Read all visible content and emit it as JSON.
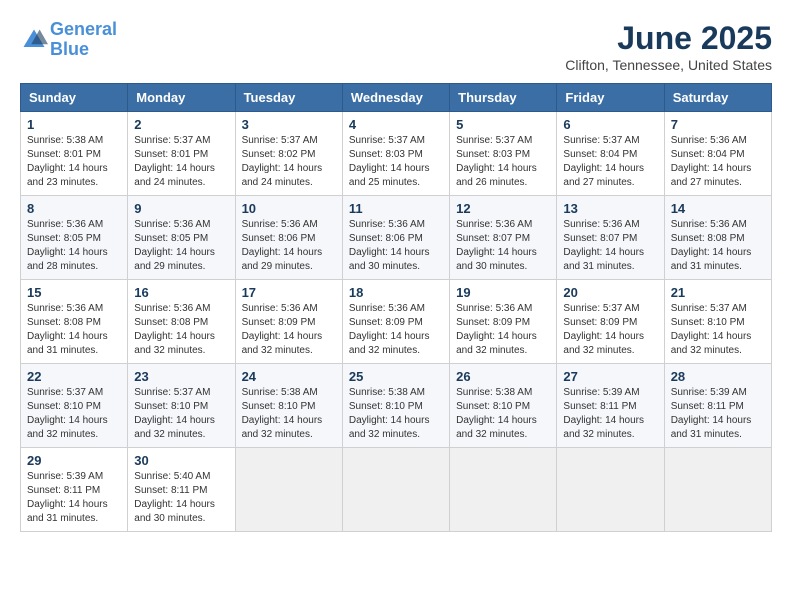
{
  "logo": {
    "line1": "General",
    "line2": "Blue"
  },
  "title": "June 2025",
  "location": "Clifton, Tennessee, United States",
  "headers": [
    "Sunday",
    "Monday",
    "Tuesday",
    "Wednesday",
    "Thursday",
    "Friday",
    "Saturday"
  ],
  "weeks": [
    [
      {
        "day": "1",
        "sunrise": "5:38 AM",
        "sunset": "8:01 PM",
        "daylight": "14 hours and 23 minutes."
      },
      {
        "day": "2",
        "sunrise": "5:37 AM",
        "sunset": "8:01 PM",
        "daylight": "14 hours and 24 minutes."
      },
      {
        "day": "3",
        "sunrise": "5:37 AM",
        "sunset": "8:02 PM",
        "daylight": "14 hours and 24 minutes."
      },
      {
        "day": "4",
        "sunrise": "5:37 AM",
        "sunset": "8:03 PM",
        "daylight": "14 hours and 25 minutes."
      },
      {
        "day": "5",
        "sunrise": "5:37 AM",
        "sunset": "8:03 PM",
        "daylight": "14 hours and 26 minutes."
      },
      {
        "day": "6",
        "sunrise": "5:37 AM",
        "sunset": "8:04 PM",
        "daylight": "14 hours and 27 minutes."
      },
      {
        "day": "7",
        "sunrise": "5:36 AM",
        "sunset": "8:04 PM",
        "daylight": "14 hours and 27 minutes."
      }
    ],
    [
      {
        "day": "8",
        "sunrise": "5:36 AM",
        "sunset": "8:05 PM",
        "daylight": "14 hours and 28 minutes."
      },
      {
        "day": "9",
        "sunrise": "5:36 AM",
        "sunset": "8:05 PM",
        "daylight": "14 hours and 29 minutes."
      },
      {
        "day": "10",
        "sunrise": "5:36 AM",
        "sunset": "8:06 PM",
        "daylight": "14 hours and 29 minutes."
      },
      {
        "day": "11",
        "sunrise": "5:36 AM",
        "sunset": "8:06 PM",
        "daylight": "14 hours and 30 minutes."
      },
      {
        "day": "12",
        "sunrise": "5:36 AM",
        "sunset": "8:07 PM",
        "daylight": "14 hours and 30 minutes."
      },
      {
        "day": "13",
        "sunrise": "5:36 AM",
        "sunset": "8:07 PM",
        "daylight": "14 hours and 31 minutes."
      },
      {
        "day": "14",
        "sunrise": "5:36 AM",
        "sunset": "8:08 PM",
        "daylight": "14 hours and 31 minutes."
      }
    ],
    [
      {
        "day": "15",
        "sunrise": "5:36 AM",
        "sunset": "8:08 PM",
        "daylight": "14 hours and 31 minutes."
      },
      {
        "day": "16",
        "sunrise": "5:36 AM",
        "sunset": "8:08 PM",
        "daylight": "14 hours and 32 minutes."
      },
      {
        "day": "17",
        "sunrise": "5:36 AM",
        "sunset": "8:09 PM",
        "daylight": "14 hours and 32 minutes."
      },
      {
        "day": "18",
        "sunrise": "5:36 AM",
        "sunset": "8:09 PM",
        "daylight": "14 hours and 32 minutes."
      },
      {
        "day": "19",
        "sunrise": "5:36 AM",
        "sunset": "8:09 PM",
        "daylight": "14 hours and 32 minutes."
      },
      {
        "day": "20",
        "sunrise": "5:37 AM",
        "sunset": "8:09 PM",
        "daylight": "14 hours and 32 minutes."
      },
      {
        "day": "21",
        "sunrise": "5:37 AM",
        "sunset": "8:10 PM",
        "daylight": "14 hours and 32 minutes."
      }
    ],
    [
      {
        "day": "22",
        "sunrise": "5:37 AM",
        "sunset": "8:10 PM",
        "daylight": "14 hours and 32 minutes."
      },
      {
        "day": "23",
        "sunrise": "5:37 AM",
        "sunset": "8:10 PM",
        "daylight": "14 hours and 32 minutes."
      },
      {
        "day": "24",
        "sunrise": "5:38 AM",
        "sunset": "8:10 PM",
        "daylight": "14 hours and 32 minutes."
      },
      {
        "day": "25",
        "sunrise": "5:38 AM",
        "sunset": "8:10 PM",
        "daylight": "14 hours and 32 minutes."
      },
      {
        "day": "26",
        "sunrise": "5:38 AM",
        "sunset": "8:10 PM",
        "daylight": "14 hours and 32 minutes."
      },
      {
        "day": "27",
        "sunrise": "5:39 AM",
        "sunset": "8:11 PM",
        "daylight": "14 hours and 32 minutes."
      },
      {
        "day": "28",
        "sunrise": "5:39 AM",
        "sunset": "8:11 PM",
        "daylight": "14 hours and 31 minutes."
      }
    ],
    [
      {
        "day": "29",
        "sunrise": "5:39 AM",
        "sunset": "8:11 PM",
        "daylight": "14 hours and 31 minutes."
      },
      {
        "day": "30",
        "sunrise": "5:40 AM",
        "sunset": "8:11 PM",
        "daylight": "14 hours and 30 minutes."
      },
      null,
      null,
      null,
      null,
      null
    ]
  ],
  "labels": {
    "sunrise": "Sunrise:",
    "sunset": "Sunset:",
    "daylight": "Daylight:"
  }
}
